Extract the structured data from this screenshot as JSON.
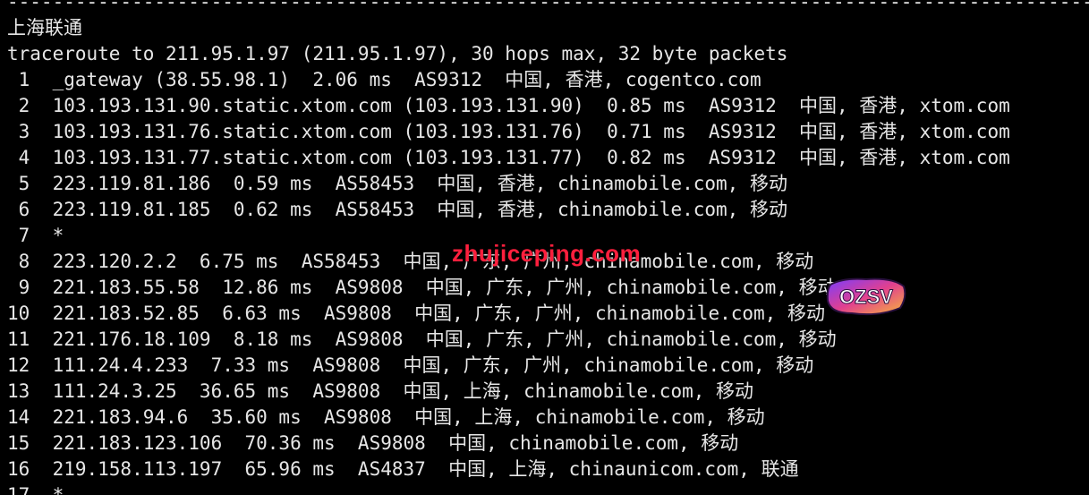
{
  "terminal": {
    "separator": "----------------------------------------------------------------------------------------------------------------",
    "title": "上海联通",
    "command": "traceroute to 211.95.1.97 (211.95.1.97), 30 hops max, 32 byte packets",
    "hops": [
      " 1  _gateway (38.55.98.1)  2.06 ms  AS9312  中国, 香港, cogentco.com",
      " 2  103.193.131.90.static.xtom.com (103.193.131.90)  0.85 ms  AS9312  中国, 香港, xtom.com",
      " 3  103.193.131.76.static.xtom.com (103.193.131.76)  0.71 ms  AS9312  中国, 香港, xtom.com",
      " 4  103.193.131.77.static.xtom.com (103.193.131.77)  0.82 ms  AS9312  中国, 香港, xtom.com",
      " 5  223.119.81.186  0.59 ms  AS58453  中国, 香港, chinamobile.com, 移动",
      " 6  223.119.81.185  0.62 ms  AS58453  中国, 香港, chinamobile.com, 移动",
      " 7  *",
      " 8  223.120.2.2  6.75 ms  AS58453  中国, 广东, 广州, chinamobile.com, 移动",
      " 9  221.183.55.58  12.86 ms  AS9808  中国, 广东, 广州, chinamobile.com, 移动",
      "10  221.183.52.85  6.63 ms  AS9808  中国, 广东, 广州, chinamobile.com, 移动",
      "11  221.176.18.109  8.18 ms  AS9808  中国, 广东, 广州, chinamobile.com, 移动",
      "12  111.24.4.233  7.33 ms  AS9808  中国, 广东, 广州, chinamobile.com, 移动",
      "13  111.24.3.25  36.65 ms  AS9808  中国, 上海, chinamobile.com, 移动",
      "14  221.183.94.6  35.60 ms  AS9808  中国, 上海, chinamobile.com, 移动",
      "15  221.183.123.106  70.36 ms  AS9808  中国, chinamobile.com, 移动",
      "16  219.158.113.197  65.96 ms  AS4837  中国, 上海, chinaunicom.com, 联通",
      "17  *"
    ]
  },
  "watermark": {
    "text": "zhujiceping.com",
    "color": "#ff1f3d"
  },
  "badge": {
    "text": "OZSV",
    "icon": "ozsv-logo-badge"
  }
}
